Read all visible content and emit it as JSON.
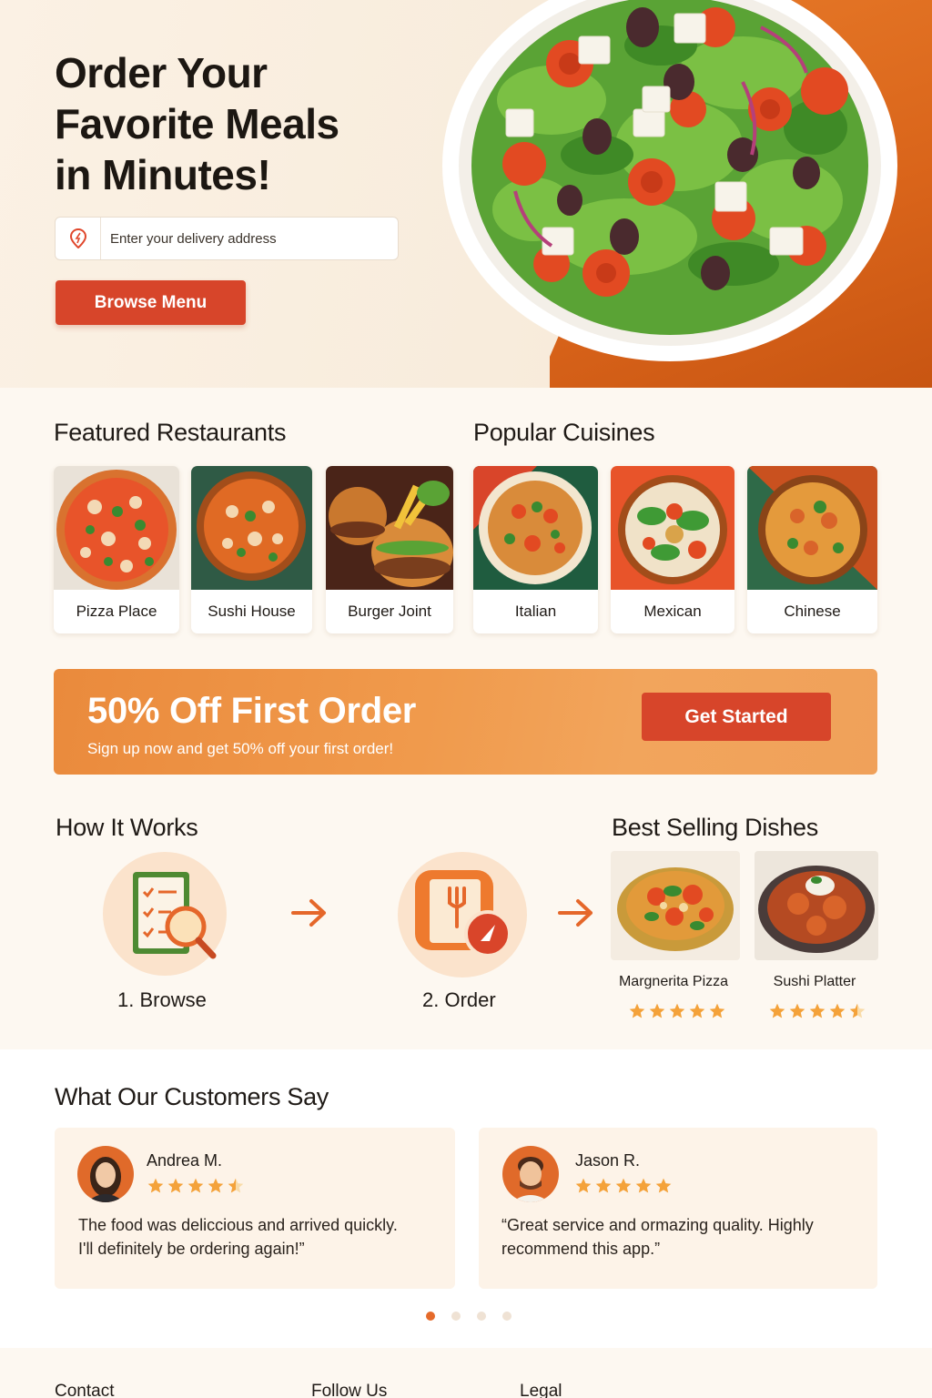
{
  "hero": {
    "title_line1": "Order Your",
    "title_line2": "Favorite Meals",
    "title_line3": "in Minutes!",
    "address_placeholder": "Enter your delivery address",
    "browse_label": "Browse Menu"
  },
  "featured": {
    "heading": "Featured Restaurants",
    "items": [
      {
        "label": "Pizza Place"
      },
      {
        "label": "Sushi House"
      },
      {
        "label": "Burger Joint"
      }
    ]
  },
  "cuisines": {
    "heading": "Popular Cuisines",
    "items": [
      {
        "label": "Italian"
      },
      {
        "label": "Mexican"
      },
      {
        "label": "Chinese"
      }
    ]
  },
  "promo": {
    "title": "50% Off First Order",
    "subtitle": "Sign up now and get 50% off your first order!",
    "cta": "Get Started"
  },
  "how_it_works": {
    "heading": "How It Works",
    "steps": [
      {
        "label": "1. Browse"
      },
      {
        "label": "2. Order"
      }
    ]
  },
  "best_selling": {
    "heading": "Best Selling Dishes",
    "dishes": [
      {
        "name": "Margnerita Pizza",
        "rating": 5
      },
      {
        "name": "Sushi Platter",
        "rating": 4.5
      }
    ]
  },
  "testimonials": {
    "heading": "What Our Customers Say",
    "items": [
      {
        "name": "Andrea M.",
        "rating": 4.5,
        "line1": "The food was deliccious and arrived quickly.",
        "line2": "I'll definitely be ordering again!”"
      },
      {
        "name": "Jason R.",
        "rating": 5,
        "line1": "“Great service and ormazing quality. Highly",
        "line2": "recommend this app.”"
      }
    ],
    "pages": 4,
    "active_page": 1
  },
  "footer": {
    "contact": "Contact",
    "follow": "Follow Us",
    "legal": "Legal"
  },
  "colors": {
    "accent": "#e56a2a",
    "button": "#d7452a",
    "star": "#f4a23a"
  }
}
